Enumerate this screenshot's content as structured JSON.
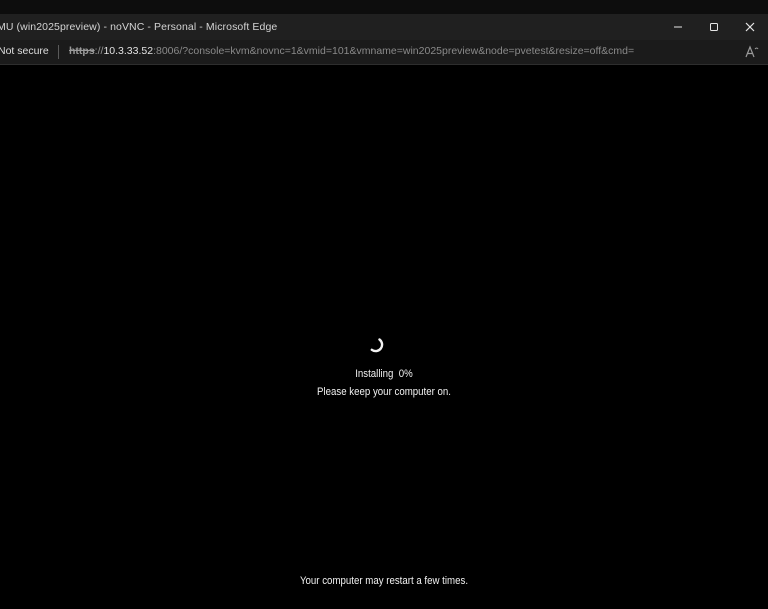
{
  "window": {
    "title": "MU (win2025preview) - noVNC - Personal - Microsoft Edge",
    "controls": {
      "minimize_icon": "minimize-icon",
      "maximize_icon": "maximize-icon",
      "close_icon": "close-icon"
    }
  },
  "addressbar": {
    "security_label": "Not secure",
    "url": {
      "scheme": "https",
      "slashes": "://",
      "host": "10.3.33.52",
      "rest": ":8006/?console=kvm&novnc=1&vmid=101&vmname=win2025preview&node=pvetest&resize=off&cmd="
    },
    "read_aloud_icon": "read-aloud-icon"
  },
  "setup": {
    "installing_label": "Installing",
    "progress_text": "0%",
    "progress": 0,
    "keep_on_message": "Please keep your computer on.",
    "restart_message": "Your computer may restart a few times.",
    "spinner_icon": "loading-spinner-icon"
  },
  "colors": {
    "background": "#000000",
    "titlebar": "#202020",
    "addressbar": "#1b1b1b",
    "text": "#f2f2f2"
  }
}
